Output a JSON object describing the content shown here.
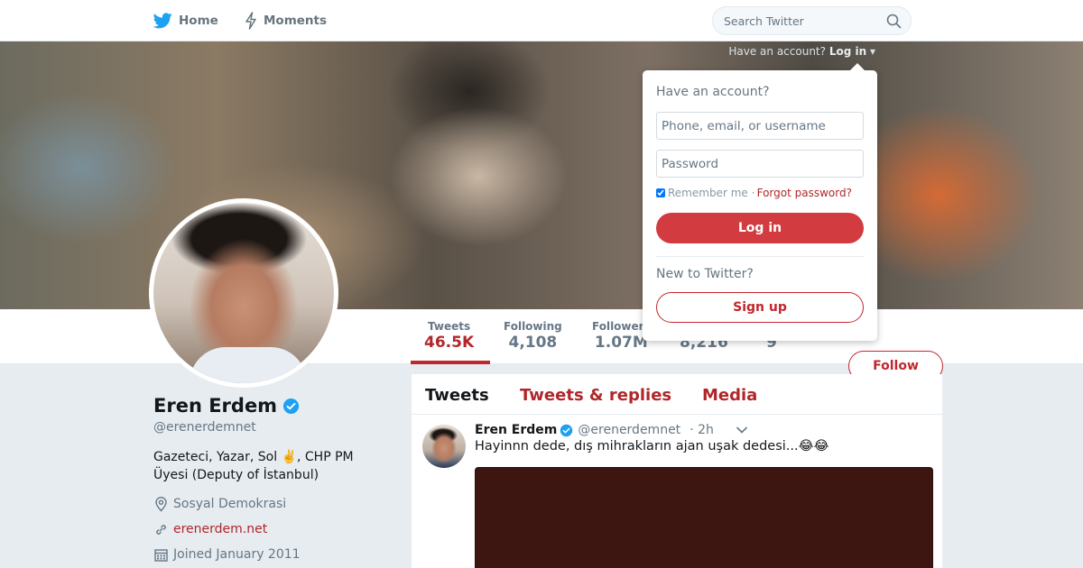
{
  "colors": {
    "accent": "#c0272d",
    "twitter_blue": "#1da1f2",
    "verified": "#1da1f2"
  },
  "nav": {
    "home_label": "Home",
    "moments_label": "Moments",
    "home_icon": "twitter-bird-icon",
    "moments_icon": "lightning-icon",
    "search_placeholder": "Search Twitter",
    "search_icon": "search-icon"
  },
  "login_hint": {
    "text": "Have an account?",
    "link": "Log in"
  },
  "login_dropdown": {
    "title": "Have an account?",
    "username_placeholder": "Phone, email, or username",
    "password_placeholder": "Password",
    "remember_label": "Remember me",
    "separator": "·",
    "forgot_label": "Forgot password?",
    "login_button": "Log in",
    "new_label": "New to Twitter?",
    "signup_button": "Sign up"
  },
  "profile": {
    "name": "Eren Erdem",
    "handle": "@erenerdemnet",
    "bio": "Gazeteci, Yazar, Sol ✌️, CHP PM Üyesi (Deputy of İstanbul)",
    "location": "Sosyal Demokrasi",
    "website": "erenerdem.net",
    "joined": "Joined January 2011",
    "follow_button": "Follow"
  },
  "stats": [
    {
      "label": "Tweets",
      "value": "46.5K"
    },
    {
      "label": "Following",
      "value": "4,108"
    },
    {
      "label": "Followers",
      "value": "1.07M"
    },
    {
      "label": "",
      "value": "8,216"
    },
    {
      "label": "",
      "value": "9"
    }
  ],
  "timeline": {
    "tabs": [
      "Tweets",
      "Tweets & replies",
      "Media"
    ],
    "tweet": {
      "name": "Eren Erdem",
      "handle": "@erenerdemnet",
      "time": "· 2h",
      "text": "Hayinnn dede, dış mihrakların ajan uşak dedesi...😂😂"
    }
  }
}
